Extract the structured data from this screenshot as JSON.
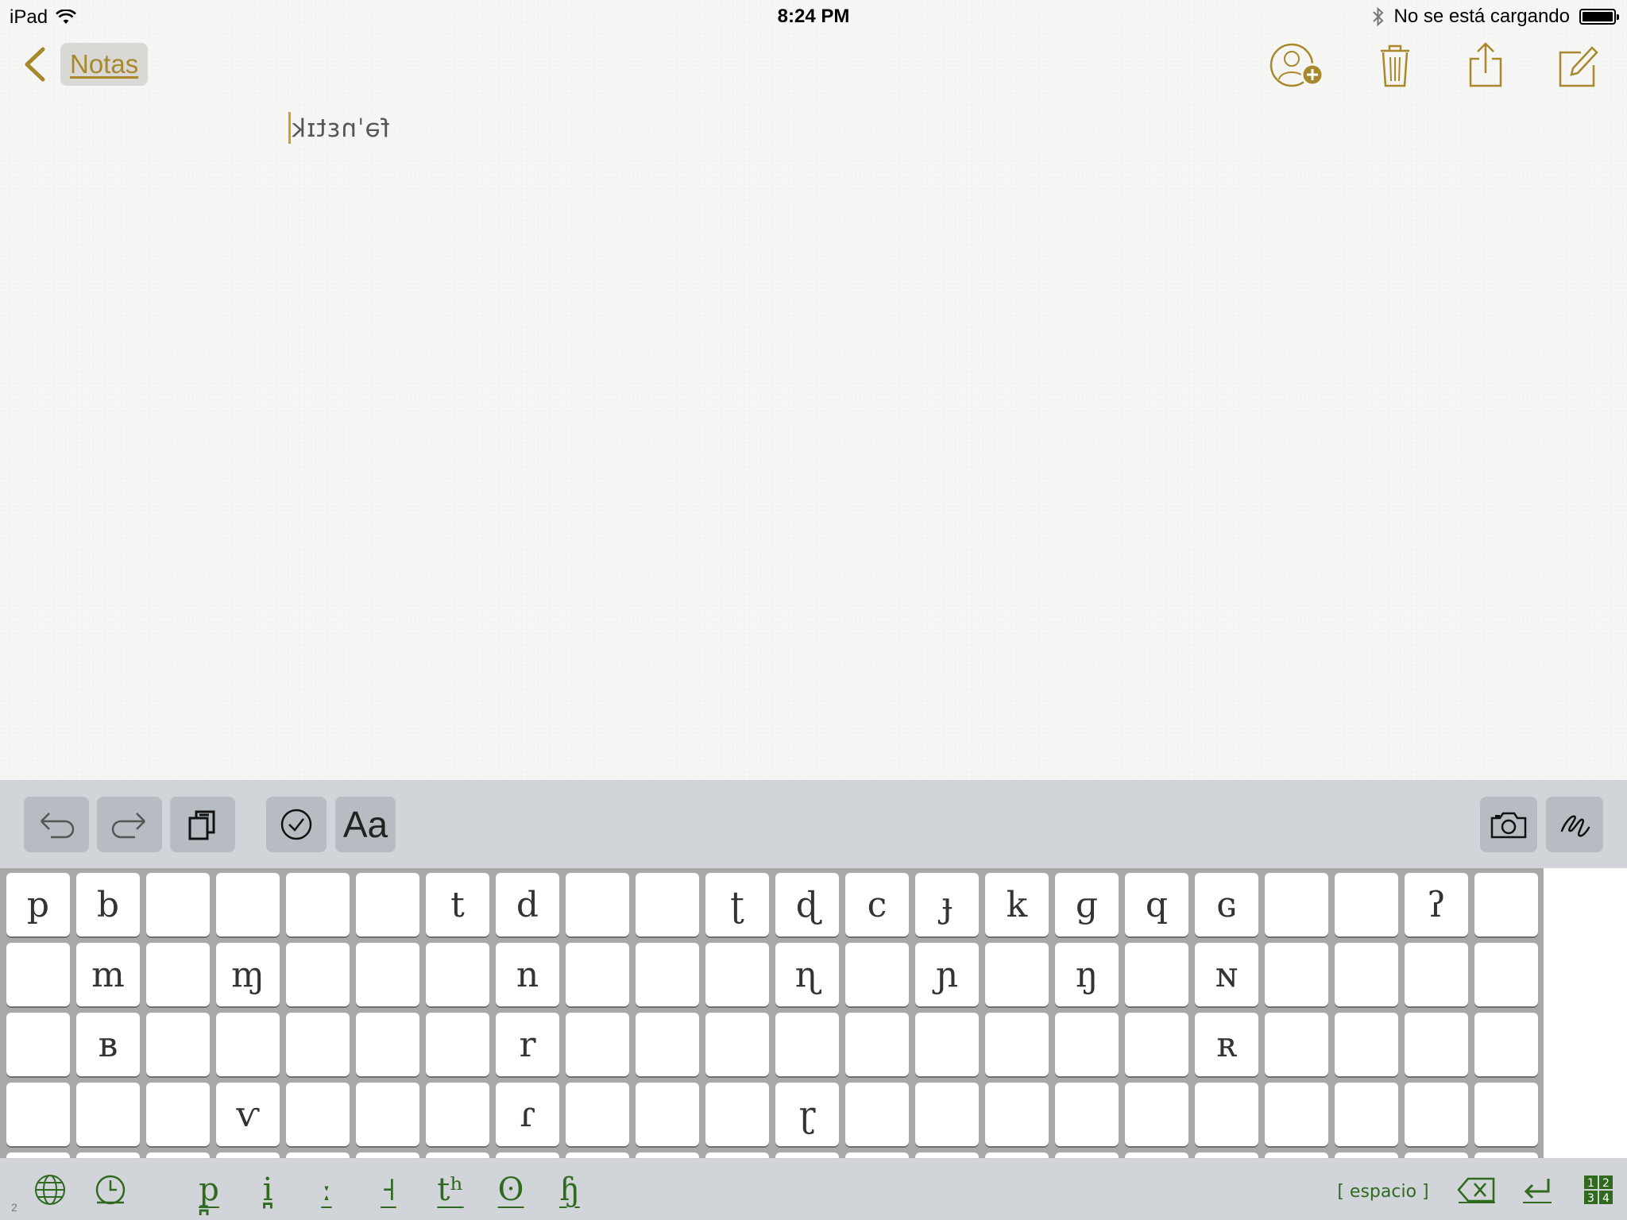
{
  "status_bar": {
    "device": "iPad",
    "time": "8:24 PM",
    "battery_text": "No se está cargando"
  },
  "nav": {
    "back_label": "Notas",
    "icons": [
      "add-person-icon",
      "trash-icon",
      "share-icon",
      "compose-icon"
    ]
  },
  "note": {
    "text": "fəˈnɛtɪk"
  },
  "toolbar": {
    "format_label": "Aa",
    "buttons": [
      "undo-icon",
      "redo-icon",
      "paste-icon",
      "checklist-icon",
      "camera-icon",
      "sketch-icon"
    ]
  },
  "keyboard": {
    "rows": [
      [
        "p",
        "b",
        "",
        "",
        "",
        "",
        "t",
        "d",
        "",
        "",
        "ʈ",
        "ɖ",
        "c",
        "ɟ",
        "k",
        "ɡ",
        "q",
        "ɢ",
        "",
        "",
        "ʔ",
        ""
      ],
      [
        "",
        "m",
        "",
        "ɱ",
        "",
        "",
        "",
        "n",
        "",
        "",
        "",
        "ɳ",
        "",
        "ɲ",
        "",
        "ŋ",
        "",
        "ɴ",
        "",
        "",
        "",
        ""
      ],
      [
        "",
        "ʙ",
        "",
        "",
        "",
        "",
        "",
        "r",
        "",
        "",
        "",
        "",
        "",
        "",
        "",
        "",
        "",
        "ʀ",
        "",
        "",
        "",
        ""
      ],
      [
        "",
        "",
        "",
        "ⱱ",
        "",
        "",
        "",
        "ɾ",
        "",
        "",
        "",
        "ɽ",
        "",
        "",
        "",
        "",
        "",
        "",
        "",
        "",
        "",
        ""
      ],
      [
        "",
        "",
        "",
        "",
        "",
        "",
        "",
        "",
        "",
        "",
        "",
        "",
        "",
        "",
        "",
        "",
        "",
        "",
        "",
        "",
        "",
        ""
      ]
    ]
  },
  "bottom_bar": {
    "diacritics": [
      "p̪",
      "i̪",
      "ː",
      "˧",
      "tʰ",
      "ʘ",
      "ɧ"
    ],
    "space_label": "[ espacio ]",
    "page_number": "2",
    "icons": [
      "globe-icon",
      "clock-icon",
      "delete-icon",
      "return-icon",
      "numbers-icon"
    ]
  },
  "colors": {
    "accent": "#c9a227",
    "accent_text": "#a8882a",
    "keyboard_green": "#2f6a1f",
    "toolbar_bg": "#d1d4d9"
  }
}
